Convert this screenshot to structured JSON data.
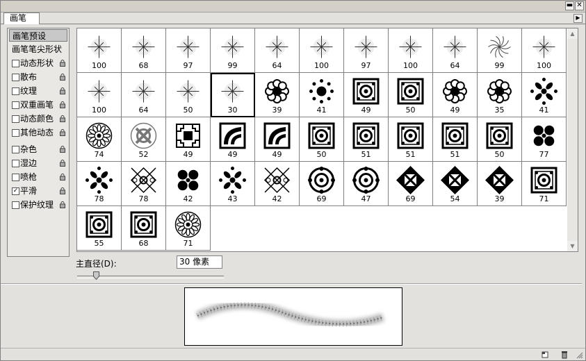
{
  "tab": {
    "label": "画笔"
  },
  "icons": {
    "minimize": "minimize-icon",
    "close": "close-icon",
    "panel_menu": "panel-menu-arrow-icon",
    "lock": "lock-icon",
    "new_brush": "create-new-brush-icon",
    "delete_brush": "delete-brush-icon",
    "resize_grip": "resize-grip-icon"
  },
  "sidebar": {
    "items": [
      {
        "label": "画笔预设",
        "checkbox": false,
        "checked": false,
        "lock": false,
        "selected": true
      },
      {
        "label": "画笔笔尖形状",
        "checkbox": false,
        "checked": false,
        "lock": false,
        "selected": false
      },
      {
        "label": "动态形状",
        "checkbox": true,
        "checked": false,
        "lock": true,
        "selected": false
      },
      {
        "label": "散布",
        "checkbox": true,
        "checked": false,
        "lock": true,
        "selected": false
      },
      {
        "label": "纹理",
        "checkbox": true,
        "checked": false,
        "lock": true,
        "selected": false
      },
      {
        "label": "双重画笔",
        "checkbox": true,
        "checked": false,
        "lock": true,
        "selected": false
      },
      {
        "label": "动态颜色",
        "checkbox": true,
        "checked": false,
        "lock": true,
        "selected": false
      },
      {
        "label": "其他动态",
        "checkbox": true,
        "checked": false,
        "lock": true,
        "selected": false
      },
      {
        "label": "杂色",
        "checkbox": true,
        "checked": false,
        "lock": true,
        "selected": false
      },
      {
        "label": "湿边",
        "checkbox": true,
        "checked": false,
        "lock": true,
        "selected": false
      },
      {
        "label": "喷枪",
        "checkbox": true,
        "checked": false,
        "lock": true,
        "selected": false
      },
      {
        "label": "平滑",
        "checkbox": true,
        "checked": true,
        "lock": true,
        "selected": false
      },
      {
        "label": "保护纹理",
        "checkbox": true,
        "checked": false,
        "lock": true,
        "selected": false
      }
    ]
  },
  "brushes": [
    {
      "size": "100",
      "kind": "star"
    },
    {
      "size": "68",
      "kind": "star"
    },
    {
      "size": "97",
      "kind": "star"
    },
    {
      "size": "99",
      "kind": "star"
    },
    {
      "size": "64",
      "kind": "star"
    },
    {
      "size": "100",
      "kind": "star"
    },
    {
      "size": "97",
      "kind": "star"
    },
    {
      "size": "100",
      "kind": "star"
    },
    {
      "size": "64",
      "kind": "star"
    },
    {
      "size": "99",
      "kind": "swirl"
    },
    {
      "size": "100",
      "kind": "star"
    },
    {
      "size": "100",
      "kind": "star"
    },
    {
      "size": "64",
      "kind": "star"
    },
    {
      "size": "50",
      "kind": "star"
    },
    {
      "size": "30",
      "kind": "star"
    },
    {
      "size": "39",
      "kind": "flower"
    },
    {
      "size": "41",
      "kind": "dots"
    },
    {
      "size": "49",
      "kind": "tile"
    },
    {
      "size": "50",
      "kind": "tile"
    },
    {
      "size": "49",
      "kind": "flower"
    },
    {
      "size": "35",
      "kind": "flower"
    },
    {
      "size": "41",
      "kind": "cross"
    },
    {
      "size": "74",
      "kind": "rosette"
    },
    {
      "size": "52",
      "kind": "knot"
    },
    {
      "size": "49",
      "kind": "fret"
    },
    {
      "size": "49",
      "kind": "fan"
    },
    {
      "size": "49",
      "kind": "fan"
    },
    {
      "size": "50",
      "kind": "tile"
    },
    {
      "size": "51",
      "kind": "tile"
    },
    {
      "size": "51",
      "kind": "tile"
    },
    {
      "size": "51",
      "kind": "tile"
    },
    {
      "size": "50",
      "kind": "tile"
    },
    {
      "size": "77",
      "kind": "clover"
    },
    {
      "size": "78",
      "kind": "cross"
    },
    {
      "size": "78",
      "kind": "ornate"
    },
    {
      "size": "42",
      "kind": "clover"
    },
    {
      "size": "43",
      "kind": "cross"
    },
    {
      "size": "42",
      "kind": "ornate"
    },
    {
      "size": "69",
      "kind": "ring"
    },
    {
      "size": "47",
      "kind": "ring"
    },
    {
      "size": "69",
      "kind": "diamond"
    },
    {
      "size": "54",
      "kind": "diamond"
    },
    {
      "size": "39",
      "kind": "diamond"
    },
    {
      "size": "71",
      "kind": "tile"
    },
    {
      "size": "55",
      "kind": "tile"
    },
    {
      "size": "68",
      "kind": "tile"
    },
    {
      "size": "71",
      "kind": "rosette"
    }
  ],
  "selected_brush": 14,
  "master_diameter": {
    "label": "主直径(D):",
    "value": "30 像素",
    "slider_fraction": 0.13
  }
}
